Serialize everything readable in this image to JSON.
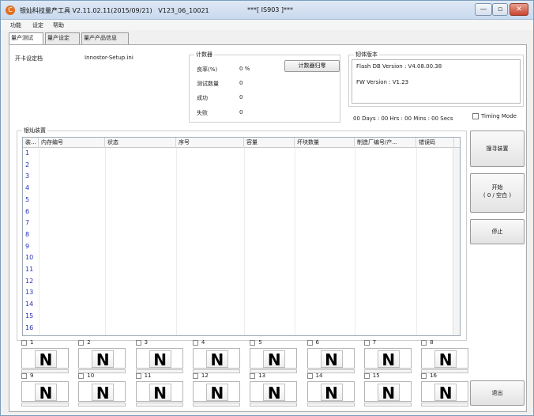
{
  "window": {
    "title": "银灿科技量产工具 V2.11.02.11(2015/09/21)   V123_06_10021",
    "center_title": "***[ IS903 ]***",
    "minimize_glyph": "—",
    "maximize_glyph": "▫",
    "close_glyph": "✕"
  },
  "menu": [
    "功能",
    "设定",
    "帮助"
  ],
  "tabs": [
    "量产测试",
    "量产设定",
    "量产产品信息"
  ],
  "config": {
    "label": "开卡设定档",
    "value": "Innostor-Setup.ini"
  },
  "counter": {
    "title": "计数器",
    "rows": [
      {
        "label": "良率(%)",
        "value": "0 %"
      },
      {
        "label": "测试数量",
        "value": "0"
      },
      {
        "label": "成功",
        "value": "0"
      },
      {
        "label": "失败",
        "value": "0"
      }
    ],
    "reset_button": "计数器归零"
  },
  "firmware": {
    "title": "韧体版本",
    "flash_db": "Flash DB Version :  V4.08.00.38",
    "fw": "FW Version :   V1.23"
  },
  "elapsed": "00 Days : 00 Hrs : 00 Mins : 00 Secs",
  "timing_mode": "Timing Mode",
  "device_group": "银灿装置",
  "columns": [
    "装...",
    "内存编号",
    "状态",
    "序号",
    "容量",
    "坏块数量",
    "制造厂编号/产...",
    "错误码"
  ],
  "rows": [
    "1",
    "2",
    "3",
    "4",
    "5",
    "6",
    "7",
    "8",
    "9",
    "10",
    "11",
    "12",
    "13",
    "14",
    "15",
    "16"
  ],
  "buttons": {
    "search": "搜寻装置",
    "start_line1": "开始",
    "start_line2": "( 0 / 空白 )",
    "stop": "停止",
    "exit": "退出"
  },
  "ports": [
    {
      "num": "1",
      "state": "N"
    },
    {
      "num": "2",
      "state": "N"
    },
    {
      "num": "3",
      "state": "N"
    },
    {
      "num": "4",
      "state": "N"
    },
    {
      "num": "5",
      "state": "N"
    },
    {
      "num": "6",
      "state": "N"
    },
    {
      "num": "7",
      "state": "N"
    },
    {
      "num": "8",
      "state": "N"
    },
    {
      "num": "9",
      "state": "N"
    },
    {
      "num": "10",
      "state": "N"
    },
    {
      "num": "11",
      "state": "N"
    },
    {
      "num": "12",
      "state": "N"
    },
    {
      "num": "13",
      "state": "N"
    },
    {
      "num": "14",
      "state": "N"
    },
    {
      "num": "15",
      "state": "N"
    },
    {
      "num": "16",
      "state": "N"
    }
  ],
  "colors": {
    "row_number": "#2230b8",
    "title_bar": "#c9d9ee",
    "close_button": "#c9452f"
  }
}
